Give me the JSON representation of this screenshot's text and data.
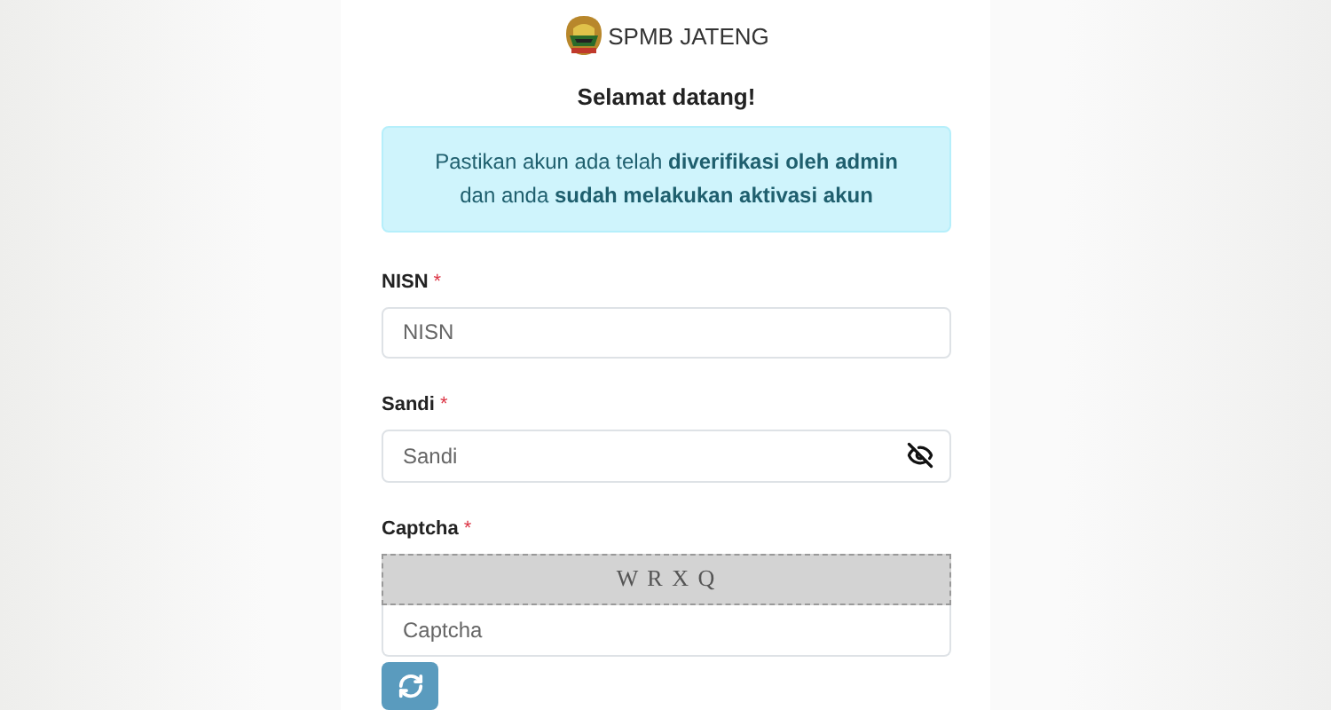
{
  "brand": {
    "name": "SPMB JATENG"
  },
  "title": "Selamat datang!",
  "alert": "Pastikan akun ada telah **diverifikasi oleh admin** dan anda **sudah melakukan aktivasi akun**",
  "fields": [
    {
      "label": "NISN",
      "required_mark": "*",
      "placeholder": "NISN",
      "kind": "text"
    },
    {
      "label": "Sandi",
      "required_mark": "*",
      "placeholder": "Sandi",
      "kind": "password"
    },
    {
      "label": "Captcha",
      "required_mark": "*",
      "placeholder": "Captcha",
      "kind": "captcha",
      "captcha_text": "W R X Q"
    }
  ]
}
